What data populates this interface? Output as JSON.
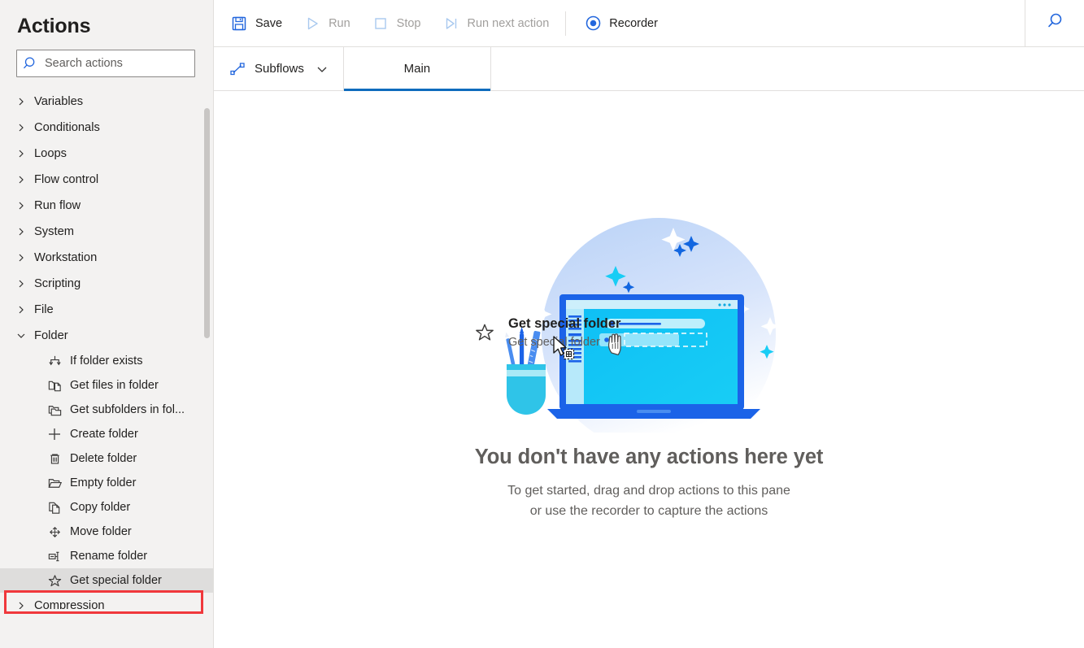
{
  "sidebar": {
    "title": "Actions",
    "search": {
      "placeholder": "Search actions",
      "value": "",
      "icon": "search-icon"
    },
    "groups": [
      {
        "label": "Variables",
        "expanded": false,
        "chevron": "chevron-right-icon"
      },
      {
        "label": "Conditionals",
        "expanded": false,
        "chevron": "chevron-right-icon"
      },
      {
        "label": "Loops",
        "expanded": false,
        "chevron": "chevron-right-icon"
      },
      {
        "label": "Flow control",
        "expanded": false,
        "chevron": "chevron-right-icon"
      },
      {
        "label": "Run flow",
        "expanded": false,
        "chevron": "chevron-right-icon"
      },
      {
        "label": "System",
        "expanded": false,
        "chevron": "chevron-right-icon"
      },
      {
        "label": "Workstation",
        "expanded": false,
        "chevron": "chevron-right-icon"
      },
      {
        "label": "Scripting",
        "expanded": false,
        "chevron": "chevron-right-icon"
      },
      {
        "label": "File",
        "expanded": false,
        "chevron": "chevron-right-icon"
      },
      {
        "label": "Folder",
        "expanded": true,
        "chevron": "chevron-down-icon"
      },
      {
        "label": "Compression",
        "expanded": false,
        "chevron": "chevron-right-icon"
      }
    ],
    "folder_actions": [
      {
        "label": "If folder exists",
        "icon": "branch-arrows-icon",
        "selected": false
      },
      {
        "label": "Get files in folder",
        "icon": "folder-file-icon",
        "selected": false
      },
      {
        "label": "Get subfolders in fol...",
        "icon": "folders-icon",
        "selected": false
      },
      {
        "label": "Create folder",
        "icon": "plus-icon",
        "selected": false
      },
      {
        "label": "Delete folder",
        "icon": "trash-icon",
        "selected": false
      },
      {
        "label": "Empty folder",
        "icon": "open-folder-icon",
        "selected": false
      },
      {
        "label": "Copy folder",
        "icon": "copy-pages-icon",
        "selected": false
      },
      {
        "label": "Move folder",
        "icon": "move-arrows-icon",
        "selected": false
      },
      {
        "label": "Rename folder",
        "icon": "rename-icon",
        "selected": false
      },
      {
        "label": "Get special folder",
        "icon": "star-icon",
        "selected": true
      }
    ],
    "highlight": {
      "color": "#f0383c",
      "target_label": "Get special folder"
    },
    "scrollbar": {
      "color": "#c8c6c4"
    }
  },
  "toolbar": {
    "buttons": [
      {
        "label": "Save",
        "icon": "save-floppy-icon",
        "disabled": false
      },
      {
        "label": "Run",
        "icon": "play-triangle-icon",
        "disabled": true
      },
      {
        "label": "Stop",
        "icon": "stop-square-icon",
        "disabled": true
      },
      {
        "label": "Run next action",
        "icon": "step-over-icon",
        "disabled": true
      },
      {
        "label": "Recorder",
        "icon": "record-circle-icon",
        "disabled": false
      }
    ],
    "search_icon": "search-icon",
    "accent_color": "#2266dd"
  },
  "tabsbar": {
    "subflows": {
      "label": "Subflows",
      "icon": "subflow-graph-icon",
      "chevron": "chevron-down-icon"
    },
    "tabs": [
      {
        "label": "Main",
        "active": true
      }
    ],
    "active_underline_color": "#0f6cbd"
  },
  "canvas": {
    "drag_ghost": {
      "title": "Get special folder",
      "subtitle": "Get special folder",
      "icon": "star-icon",
      "cursor": "drag-copy-cursor"
    },
    "empty_state": {
      "illustration": "laptop-drag-drop-illustration",
      "title": "You don't have any actions here yet",
      "line1": "To get started, drag and drop actions to this pane",
      "line2": "or use the recorder to capture the actions"
    }
  }
}
